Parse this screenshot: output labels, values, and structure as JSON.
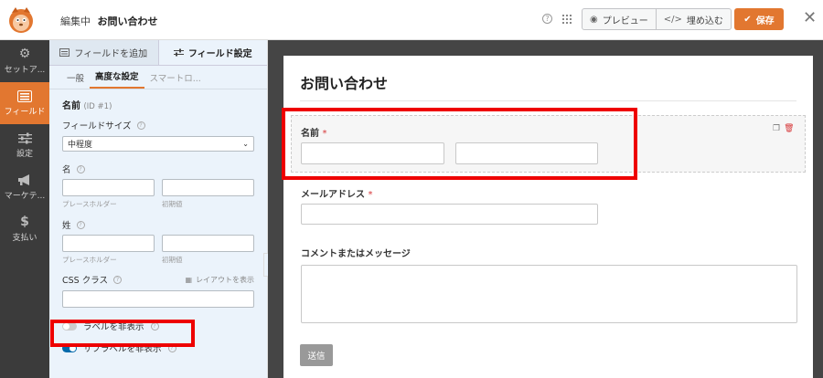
{
  "header": {
    "editing_label": "編集中",
    "form_name": "お問い合わせ",
    "help_glyph": "?",
    "preview_label": "プレビュー",
    "embed_label": "埋め込む",
    "save_label": "保存",
    "close_glyph": "✕",
    "accent_color": "#e27730"
  },
  "leftnav": {
    "items": [
      {
        "label": "セットア...",
        "icon": "gear-icon"
      },
      {
        "label": "フィールド",
        "icon": "fields-icon",
        "active": true
      },
      {
        "label": "設定",
        "icon": "sliders-icon"
      },
      {
        "label": "マーケテ...",
        "icon": "megaphone-icon"
      },
      {
        "label": "支払い",
        "icon": "dollar-icon"
      }
    ]
  },
  "panel": {
    "tabs": [
      "フィールドを追加",
      "フィールド設定"
    ],
    "subtabs": [
      "一般",
      "高度な設定",
      "スマートロ..."
    ],
    "field_title": "名前",
    "field_id": "(ID #1)",
    "field_size_label": "フィールドサイズ",
    "field_size_value": "中程度",
    "first_label": "名",
    "last_label": "姓",
    "placeholder_sub": "プレースホルダー",
    "default_sub": "初期値",
    "css_label": "CSS クラス",
    "layout_link": "レイアウトを表示",
    "hide_label": "ラベルを非表示",
    "hide_sublabel": "サブラベルを非表示"
  },
  "preview": {
    "title": "お問い合わせ",
    "name_label": "名前",
    "email_label": "メールアドレス",
    "required_mark": "*",
    "comment_label": "コメントまたはメッセージ",
    "submit_label": "送信"
  }
}
